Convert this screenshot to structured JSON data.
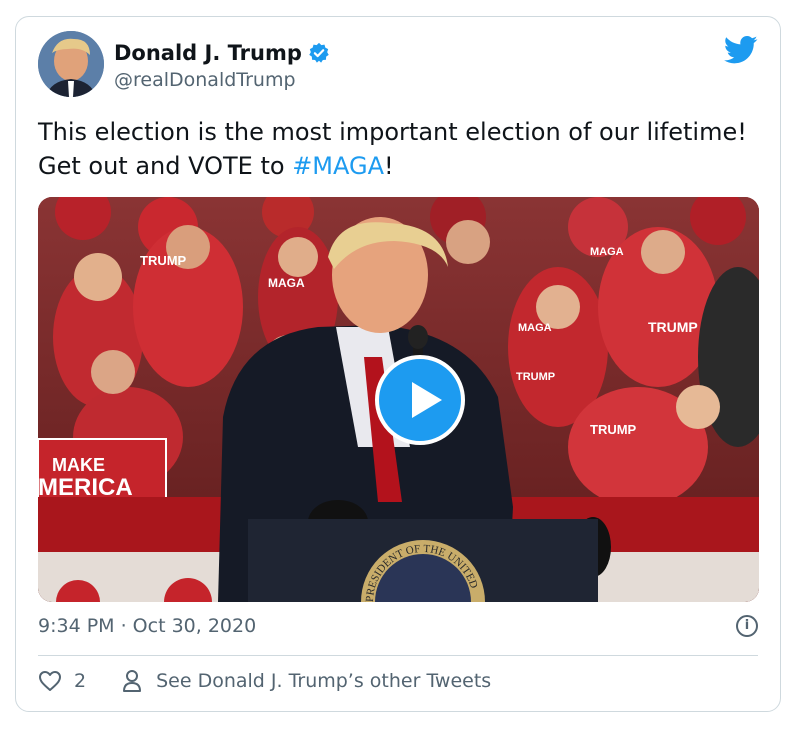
{
  "author": {
    "name": "Donald J. Trump",
    "handle": "@realDonaldTrump"
  },
  "tweet": {
    "text_before": "This election is the most important election of our lifetime! Get out and VOTE to ",
    "hashtag": "#MAGA",
    "text_after": "!"
  },
  "media": {
    "type": "video",
    "crowd_signs": [
      "MAKE",
      "MERICA",
      "TRUMP",
      "MAGA",
      "TRUMP",
      "TRUMP",
      "TRUMP",
      "MAGA",
      "MAGA"
    ],
    "podium_seal_text": "PRESIDENT OF THE UNITED"
  },
  "meta": {
    "timestamp": "9:34 PM · Oct 30, 2020"
  },
  "actions": {
    "like_count": "2",
    "other_tweets_label": "See Donald J. Trump’s other Tweets"
  },
  "colors": {
    "accent": "#1d9bf0",
    "text": "#0f1419",
    "secondary": "#536471",
    "border": "#cfd9de"
  },
  "icons": {
    "brand": "twitter-bird-icon",
    "verified": "verified-badge-icon",
    "play": "play-icon",
    "info": "info-icon",
    "like": "heart-icon",
    "profile": "person-icon"
  }
}
